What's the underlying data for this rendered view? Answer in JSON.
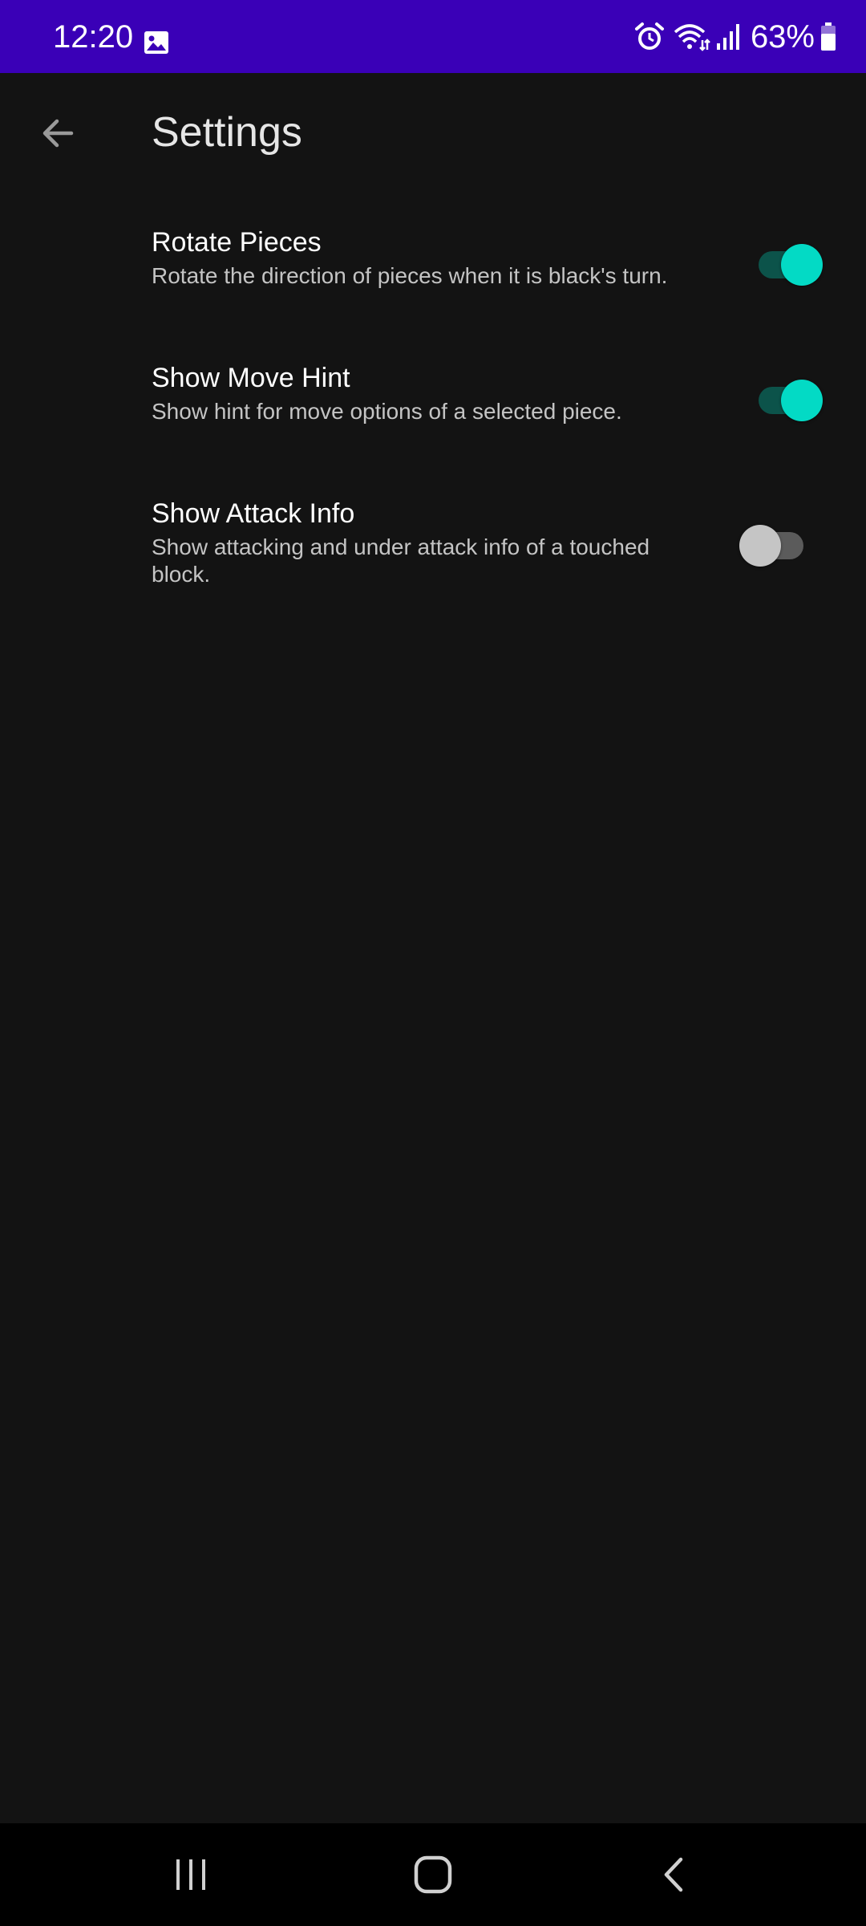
{
  "status_bar": {
    "time": "12:20",
    "battery_percent": "63%",
    "background_color": "#3a00b7",
    "icons": [
      "gallery-icon",
      "alarm-icon",
      "wifi-icon",
      "signal-icon",
      "battery-icon"
    ]
  },
  "app_bar": {
    "title": "Settings",
    "back_icon": "arrow-left-icon"
  },
  "settings": [
    {
      "title": "Rotate Pieces",
      "description": "Rotate the direction of pieces when it is black's turn.",
      "enabled": true
    },
    {
      "title": "Show Move Hint",
      "description": "Show hint for move options of a selected piece.",
      "enabled": true
    },
    {
      "title": "Show Attack Info",
      "description": "Show attacking and under attack info of a touched block.",
      "enabled": false
    }
  ],
  "colors": {
    "background": "#131313",
    "accent": "#03dac5"
  },
  "nav_bar": {
    "buttons": [
      "recent-apps-icon",
      "home-icon",
      "back-icon"
    ]
  }
}
